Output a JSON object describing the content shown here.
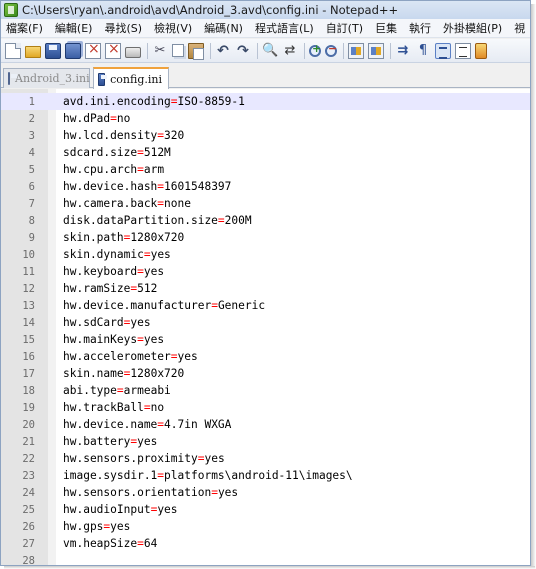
{
  "window": {
    "title": "C:\\Users\\ryan\\.android\\avd\\Android_3.avd\\config.ini - Notepad++"
  },
  "menubar": {
    "items": [
      "檔案(F)",
      "編輯(E)",
      "尋找(S)",
      "檢視(V)",
      "編碼(N)",
      "程式語言(L)",
      "自訂(T)",
      "巨集",
      "執行",
      "外掛模組(P)",
      "視"
    ]
  },
  "toolbar": {
    "icons": [
      "new-file-icon",
      "open-folder-icon",
      "save-icon",
      "save-all-icon",
      "close-icon",
      "close-all-icon",
      "print-icon",
      "cut-icon",
      "copy-icon",
      "paste-icon",
      "undo-icon",
      "redo-icon",
      "find-icon",
      "replace-icon",
      "zoom-in-icon",
      "zoom-out-icon",
      "sync-scroll-icon",
      "sync-horizontal-icon",
      "word-wrap-icon",
      "show-all-chars-icon",
      "indent-guide-icon",
      "list-icon",
      "more-icon"
    ]
  },
  "tabs": [
    {
      "label": "Android_3.ini",
      "active": false
    },
    {
      "label": "config.ini",
      "active": true
    }
  ],
  "editor": {
    "current_line": 1,
    "lines": [
      {
        "n": "1",
        "key": "avd.ini.encoding",
        "val": "ISO-8859-1"
      },
      {
        "n": "2",
        "key": "hw.dPad",
        "val": "no"
      },
      {
        "n": "3",
        "key": "hw.lcd.density",
        "val": "320"
      },
      {
        "n": "4",
        "key": "sdcard.size",
        "val": "512M"
      },
      {
        "n": "5",
        "key": "hw.cpu.arch",
        "val": "arm"
      },
      {
        "n": "6",
        "key": "hw.device.hash",
        "val": "1601548397"
      },
      {
        "n": "7",
        "key": "hw.camera.back",
        "val": "none"
      },
      {
        "n": "8",
        "key": "disk.dataPartition.size",
        "val": "200M"
      },
      {
        "n": "9",
        "key": "skin.path",
        "val": "1280x720"
      },
      {
        "n": "10",
        "key": "skin.dynamic",
        "val": "yes"
      },
      {
        "n": "11",
        "key": "hw.keyboard",
        "val": "yes"
      },
      {
        "n": "12",
        "key": "hw.ramSize",
        "val": "512"
      },
      {
        "n": "13",
        "key": "hw.device.manufacturer",
        "val": "Generic"
      },
      {
        "n": "14",
        "key": "hw.sdCard",
        "val": "yes"
      },
      {
        "n": "15",
        "key": "hw.mainKeys",
        "val": "yes"
      },
      {
        "n": "16",
        "key": "hw.accelerometer",
        "val": "yes"
      },
      {
        "n": "17",
        "key": "skin.name",
        "val": "1280x720"
      },
      {
        "n": "18",
        "key": "abi.type",
        "val": "armeabi"
      },
      {
        "n": "19",
        "key": "hw.trackBall",
        "val": "no"
      },
      {
        "n": "20",
        "key": "hw.device.name",
        "val": "4.7in WXGA"
      },
      {
        "n": "21",
        "key": "hw.battery",
        "val": "yes"
      },
      {
        "n": "22",
        "key": "hw.sensors.proximity",
        "val": "yes"
      },
      {
        "n": "23",
        "key": "image.sysdir.1",
        "val": "platforms\\android-11\\images\\"
      },
      {
        "n": "24",
        "key": "hw.sensors.orientation",
        "val": "yes"
      },
      {
        "n": "25",
        "key": "hw.audioInput",
        "val": "yes"
      },
      {
        "n": "26",
        "key": "hw.gps",
        "val": "yes"
      },
      {
        "n": "27",
        "key": "vm.heapSize",
        "val": "64"
      },
      {
        "n": "28",
        "key": "",
        "val": ""
      }
    ]
  },
  "colors": {
    "operator": "#ff0000",
    "active_tab_accent": "#f0a23c",
    "current_line_bg": "#e8e8ff",
    "gutter_bg": "#e4e4e4"
  }
}
